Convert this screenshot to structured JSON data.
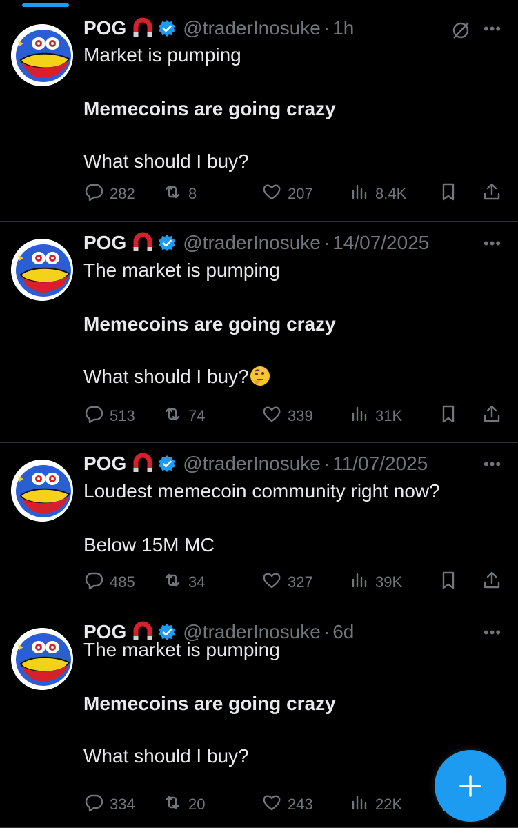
{
  "tweets": [
    {
      "name": "POG",
      "handle": "@traderInosuke",
      "separator": "·",
      "time": "1h",
      "show_grok": true,
      "lines": [
        {
          "text": "Market is pumping",
          "bold": false,
          "emoji": false
        },
        {
          "text": "Memecoins are going crazy",
          "bold": true,
          "emoji": false
        },
        {
          "text": "What should I buy?",
          "bold": false,
          "emoji": false
        }
      ],
      "replies": "282",
      "reposts": "8",
      "likes": "207",
      "views": "8.4K"
    },
    {
      "name": "POG",
      "handle": "@traderInosuke",
      "separator": "·",
      "time": "14/07/2025",
      "show_grok": false,
      "lines": [
        {
          "text": "The market is pumping",
          "bold": false,
          "emoji": false
        },
        {
          "text": "Memecoins are going crazy",
          "bold": true,
          "emoji": false
        },
        {
          "text": "What should I buy?",
          "bold": false,
          "emoji": true
        }
      ],
      "replies": "513",
      "reposts": "74",
      "likes": "339",
      "views": "31K"
    },
    {
      "name": "POG",
      "handle": "@traderInosuke",
      "separator": "·",
      "time": "11/07/2025",
      "show_grok": false,
      "lines": [
        {
          "text": "Loudest memecoin community right now?",
          "bold": false,
          "emoji": false
        },
        {
          "text": "Below 15M MC",
          "bold": false,
          "emoji": false
        }
      ],
      "replies": "485",
      "reposts": "34",
      "likes": "327",
      "views": "39K"
    },
    {
      "name": "POG",
      "handle": "@traderInosuke",
      "separator": "·",
      "time": "6d",
      "show_grok": false,
      "lines": [
        {
          "text": "The market is pumping",
          "bold": false,
          "emoji": false
        },
        {
          "text": "Memecoins are going crazy",
          "bold": true,
          "emoji": false
        },
        {
          "text": "What should I buy?",
          "bold": false,
          "emoji": false
        }
      ],
      "replies": "334",
      "reposts": "20",
      "likes": "243",
      "views": "22K"
    }
  ],
  "icons": {
    "reply": "reply-icon",
    "repost": "repost-icon",
    "like": "heart-icon",
    "views": "views-icon",
    "bookmark": "bookmark-icon",
    "share": "share-icon",
    "compose": "plus-icon",
    "badge": "verified-badge-icon",
    "emoji_badge": "magnet-emoji",
    "thinking": "thinking-face-emoji"
  },
  "colors": {
    "background": "#000000",
    "accent": "#1d9bf0",
    "text": "#e7e9ea",
    "muted": "#71767b",
    "divider": "#2f3336"
  }
}
